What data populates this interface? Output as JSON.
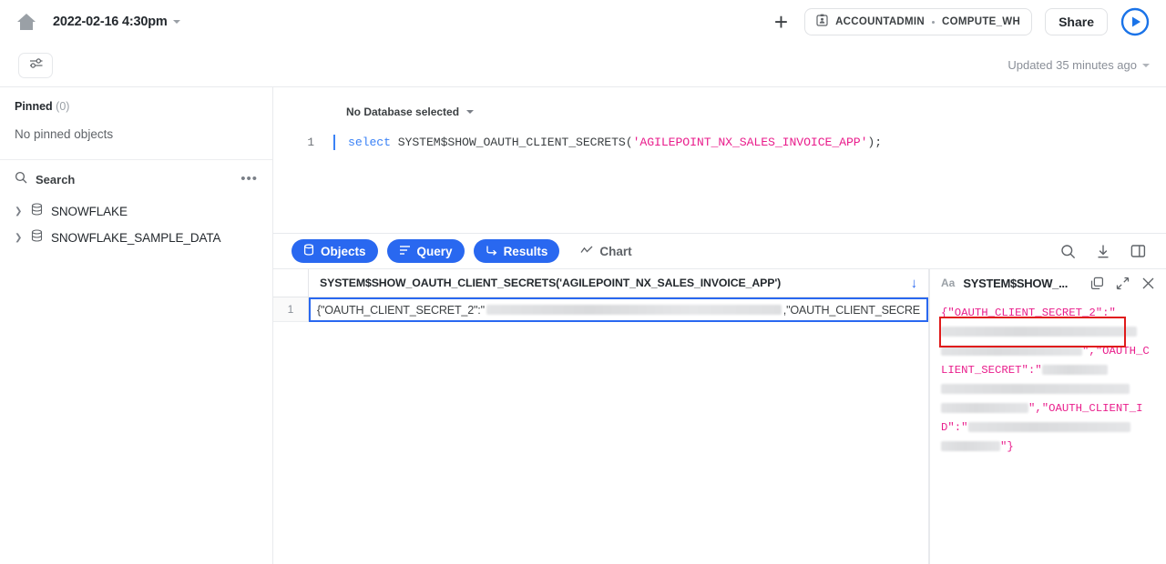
{
  "header": {
    "home_icon": "home-icon",
    "timestamp": "2022-02-16 4:30pm",
    "add_label": "+",
    "role": "ACCOUNTADMIN",
    "warehouse": "COMPUTE_WH",
    "share_label": "Share",
    "run_icon": "play-circle-icon",
    "badge_icon": "id-badge-icon"
  },
  "subbar": {
    "filter_icon": "sliders-icon",
    "updated_label": "Updated 35 minutes ago"
  },
  "sidebar": {
    "pinned_label": "Pinned",
    "pinned_count": "(0)",
    "empty_label": "No pinned objects",
    "search_label": "Search",
    "search_icon": "search-icon",
    "more_icon": "ellipsis-icon",
    "databases": [
      {
        "name": "SNOWFLAKE",
        "icon": "database-icon",
        "chevron": "chevron-right-icon"
      },
      {
        "name": "SNOWFLAKE_SAMPLE_DATA",
        "icon": "database-icon",
        "chevron": "chevron-right-icon"
      }
    ]
  },
  "editor": {
    "database_selector": "No Database selected",
    "line_number": "1",
    "sql": {
      "keyword": "select",
      "function": " SYSTEM$SHOW_OAUTH_CLIENT_SECRETS(",
      "string": "'AGILEPOINT_NX_SALES_INVOICE_APP'",
      "tail": ");"
    }
  },
  "tabs": [
    {
      "label": "Objects",
      "icon": "database-icon",
      "active": true
    },
    {
      "label": "Query",
      "icon": "list-lines-icon",
      "active": true
    },
    {
      "label": "Results",
      "icon": "arrow-turn-icon",
      "active": true
    },
    {
      "label": "Chart",
      "icon": "line-chart-icon",
      "active": false
    }
  ],
  "tab_tools": [
    {
      "icon": "search-icon"
    },
    {
      "icon": "download-icon"
    },
    {
      "icon": "split-pane-icon"
    }
  ],
  "results": {
    "column_header": "SYSTEM$SHOW_OAUTH_CLIENT_SECRETS('AGILEPOINT_NX_SALES_INVOICE_APP')",
    "sort_icon": "arrow-down-icon",
    "row_number": "1",
    "cell_prefix": "{\"OAUTH_CLIENT_SECRET_2\":\"",
    "cell_suffix": ",\"OAUTH_CLIENT_SECRE"
  },
  "detail_panel": {
    "format_icon": "Aa",
    "title": "SYSTEM$SHOW_...",
    "copy_icon": "copy-icon",
    "expand_icon": "expand-icon",
    "close_icon": "close-icon",
    "json_parts": {
      "p1": "{\"OAUTH_CLIENT_SECRET_2\":\"",
      "p2": "\",\"OAUTH",
      "p3": "_CLIENT_SECRET\":\"",
      "p4": "\",\"OAUTH_CLIENT_I",
      "p5": "D\":\"",
      "p6": "\"}"
    }
  },
  "colors": {
    "accent_blue": "#2968f0",
    "string_pink": "#e91e8c",
    "keyword_blue": "#3b82f6",
    "annotation_red": "#e01b1b",
    "border_gray": "#e8eaed"
  }
}
